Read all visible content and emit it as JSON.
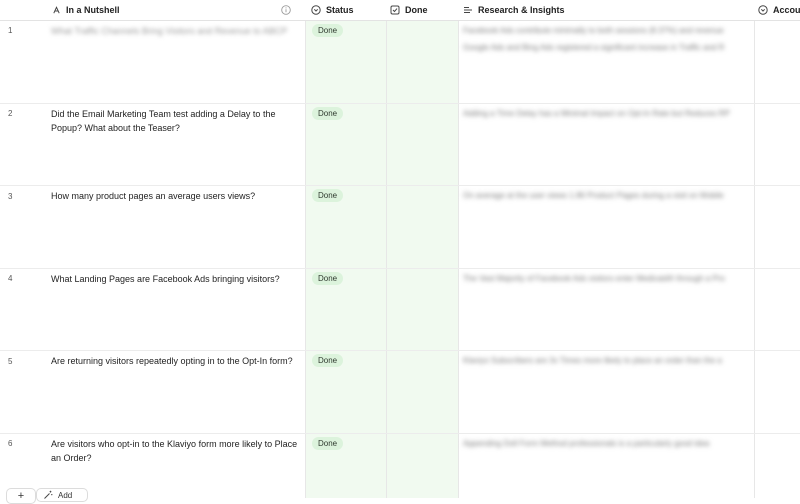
{
  "columns": {
    "nutshell": "In a Nutshell",
    "status": "Status",
    "done": "Done",
    "research": "Research & Insights",
    "account": "Accoun"
  },
  "rows": [
    {
      "num": "1",
      "question": "What Traffic Channels Bring Visitors and Revenue to ABCP",
      "status": "Done",
      "insight1": "Facebook Ads contribute minimally to both sessions (8.37%) and revenue",
      "insight2": "Google Ads and Bing Ads registered a significant increase in Traffic and R"
    },
    {
      "num": "2",
      "question": "Did the Email Marketing Team test adding a Delay to the Popup? What about the Teaser?",
      "status": "Done",
      "insight1": "Adding a Time Delay has a Minimal Impact on Opt-In Rate but Reduces RP",
      "insight2": ""
    },
    {
      "num": "3",
      "question": "How many product pages an average users views?",
      "status": "Done",
      "insight1": "On average at the user views 1.86 Product Pages during a visit on Mobile",
      "insight2": ""
    },
    {
      "num": "4",
      "question": "What Landing Pages are Facebook Ads bringing visitors?",
      "status": "Done",
      "insight1": "The Vast Majority of Facebook Ads visitors enter Medicaid® through a Pro",
      "insight2": ""
    },
    {
      "num": "5",
      "question": "Are returning visitors repeatedly opting in to the Opt-In form?",
      "status": "Done",
      "insight1": "Klaviyo Subscribers are 3x Times more likely to place an order than the a",
      "insight2": ""
    },
    {
      "num": "6",
      "question": "Are visitors who opt-in to the Klaviyo form more likely to Place an Order?",
      "status": "Done",
      "insight1": "Appending Doll Form Method professionals is a particularly good idea",
      "insight2": ""
    }
  ],
  "footer": {
    "add_label": "Add",
    "plus": "+"
  },
  "colors": {
    "status_column_bg": "#f1faf0",
    "badge_bg": "#dcf3dc"
  }
}
